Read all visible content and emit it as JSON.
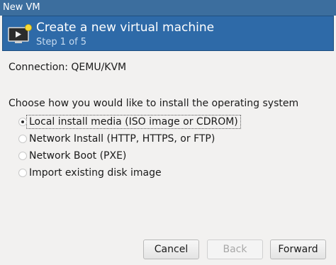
{
  "window": {
    "title": "New VM"
  },
  "header": {
    "icon": "monitor-new-icon",
    "title": "Create a new virtual machine",
    "step": "Step 1 of 5"
  },
  "connection": "Connection: QEMU/KVM",
  "prompt": "Choose how you would like to install the operating system",
  "options": [
    {
      "label": "Local install media (ISO image or CDROM)",
      "selected": true
    },
    {
      "label": "Network Install (HTTP, HTTPS, or FTP)",
      "selected": false
    },
    {
      "label": "Network Boot (PXE)",
      "selected": false
    },
    {
      "label": "Import existing disk image",
      "selected": false
    }
  ],
  "buttons": {
    "cancel": "Cancel",
    "back": "Back",
    "forward": "Forward"
  },
  "colors": {
    "header_bg": "#2e6aa8",
    "titlebar_bg": "#3c6e9e"
  }
}
